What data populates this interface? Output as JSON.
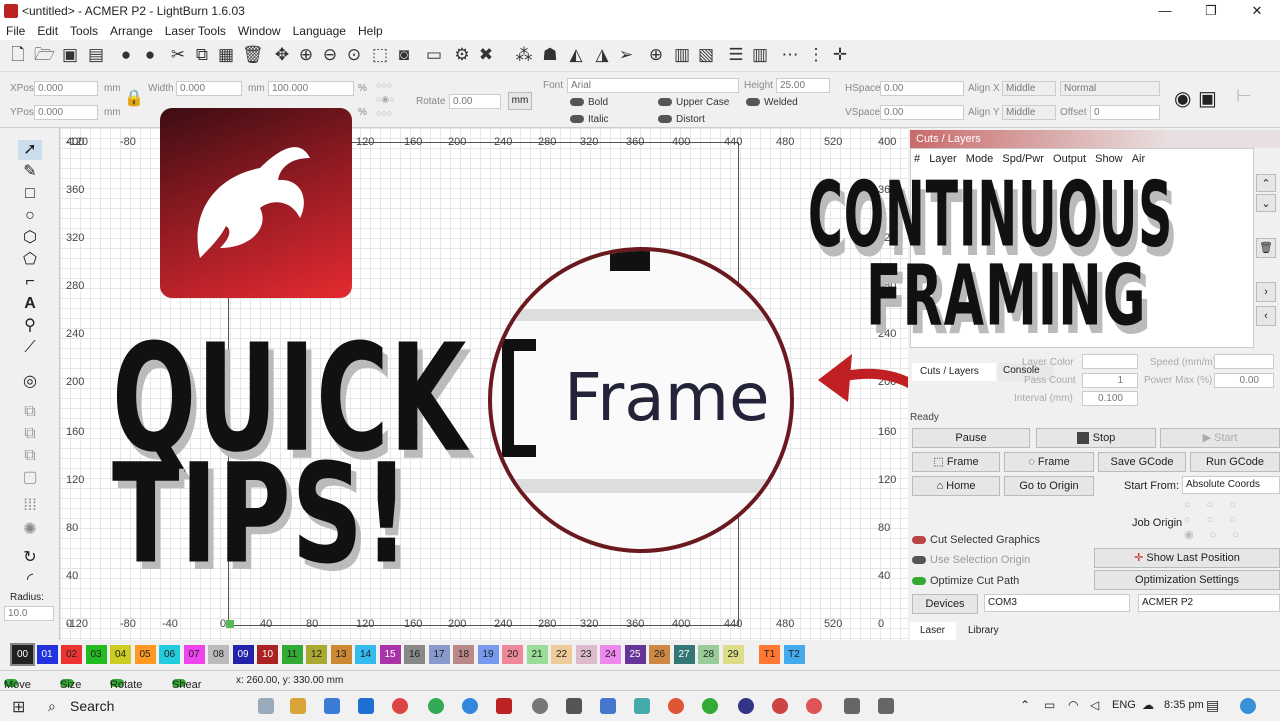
{
  "window": {
    "title": "<untitled> - ACMER P2 - LightBurn 1.6.03"
  },
  "menu": [
    "File",
    "Edit",
    "Tools",
    "Arrange",
    "Laser Tools",
    "Window",
    "Language",
    "Help"
  ],
  "position": {
    "xpos_label": "XPos",
    "xpos_value": "0.000",
    "ypos_label": "YPos",
    "ypos_value": "0.000",
    "unit": "mm",
    "width_label": "Width",
    "width_value": "0.000",
    "height_label": "Height",
    "height_value": "",
    "scale_value": "100.000",
    "pct": "%",
    "rotate_label": "Rotate",
    "rotate_value": "0.00",
    "mm_button": "mm"
  },
  "font_bar": {
    "font_label": "Font",
    "font_value": "Arial",
    "height_label": "Height",
    "height_value": "25.00",
    "hspace_label": "HSpace",
    "hspace_value": "0.00",
    "vspace_label": "VSpace",
    "vspace_value": "0.00",
    "alignx_label": "Align X",
    "alignx_value": "Middle",
    "aligny_label": "Align Y",
    "aligny_value": "Middle",
    "style_value": "Normal",
    "offset_label": "Offset",
    "offset_value": "0",
    "bold": "Bold",
    "italic": "Italic",
    "upper": "Upper Case",
    "distort": "Distort",
    "welded": "Welded"
  },
  "rulers": {
    "top": [
      "-120",
      "-80",
      "-40",
      "0",
      "40",
      "80",
      "120",
      "160",
      "200",
      "240",
      "280",
      "320",
      "360",
      "400",
      "440",
      "480",
      "520"
    ],
    "left": [
      "400",
      "360",
      "320",
      "280",
      "240",
      "200",
      "160",
      "120",
      "80",
      "40",
      "0"
    ],
    "bottom": [
      "-120",
      "-80",
      "-40",
      "0",
      "40",
      "80",
      "120",
      "160",
      "200",
      "240",
      "280",
      "320",
      "360",
      "400",
      "440",
      "480",
      "520"
    ],
    "right": [
      "400",
      "360",
      "320",
      "280",
      "240",
      "200",
      "160",
      "120",
      "80",
      "40",
      "0"
    ]
  },
  "left_tools": {
    "radius_label": "Radius:",
    "radius_value": "10.0"
  },
  "overlay": {
    "quick": "QUICK",
    "tips": "TIPS!",
    "continuous": "CONTINUOUS",
    "framing": "FRAMING",
    "frame_zoom": "Frame"
  },
  "cuts": {
    "panel_title": "Cuts / Layers",
    "columns": [
      "#",
      "Layer",
      "Mode",
      "Spd/Pwr",
      "Output",
      "Show",
      "Air"
    ],
    "tab_cuts": "Cuts / Layers",
    "tab_console": "Console",
    "layer_color": "Layer Color",
    "speed": "Speed (mm/m)",
    "pass_count": "Pass Count",
    "pass_value": "1",
    "power_max": "Power Max (%)",
    "power_value": "0.00",
    "interval": "Interval (mm)",
    "interval_value": "0.100"
  },
  "laser": {
    "ready": "Ready",
    "pause": "Pause",
    "stop": "Stop",
    "start": "Start",
    "frame1": "Frame",
    "frame2": "Frame",
    "save_gcode": "Save GCode",
    "run_gcode": "Run GCode",
    "home": "Home",
    "go_origin": "Go to Origin",
    "start_from_label": "Start From:",
    "start_from_value": "Absolute Coords",
    "job_origin": "Job Origin",
    "cut_selected": "Cut Selected Graphics",
    "use_selection": "Use Selection Origin",
    "optimize": "Optimize Cut Path",
    "show_last": "Show Last Position",
    "opt_settings": "Optimization Settings",
    "devices": "Devices",
    "com": "COM3",
    "device_name": "ACMER P2",
    "tab_laser": "Laser",
    "tab_library": "Library"
  },
  "palette": [
    {
      "n": "00",
      "c": "#222222"
    },
    {
      "n": "01",
      "c": "#2233dd"
    },
    {
      "n": "02",
      "c": "#ee3333"
    },
    {
      "n": "03",
      "c": "#22bb22"
    },
    {
      "n": "04",
      "c": "#cccc22"
    },
    {
      "n": "05",
      "c": "#ff9922"
    },
    {
      "n": "06",
      "c": "#22ccdd"
    },
    {
      "n": "07",
      "c": "#ee44ee"
    },
    {
      "n": "08",
      "c": "#bbbbbb"
    },
    {
      "n": "09",
      "c": "#2222aa"
    },
    {
      "n": "10",
      "c": "#aa2222"
    },
    {
      "n": "11",
      "c": "#33aa33"
    },
    {
      "n": "12",
      "c": "#aaaa33"
    },
    {
      "n": "13",
      "c": "#cc8833"
    },
    {
      "n": "14",
      "c": "#33bbee"
    },
    {
      "n": "15",
      "c": "#aa33aa"
    },
    {
      "n": "16",
      "c": "#888888"
    },
    {
      "n": "17",
      "c": "#8899cc"
    },
    {
      "n": "18",
      "c": "#bb8888"
    },
    {
      "n": "19",
      "c": "#7799ee"
    },
    {
      "n": "20",
      "c": "#ee8899"
    },
    {
      "n": "21",
      "c": "#99dd99"
    },
    {
      "n": "22",
      "c": "#eecc99"
    },
    {
      "n": "23",
      "c": "#ddbbcc"
    },
    {
      "n": "24",
      "c": "#ee88ee"
    },
    {
      "n": "25",
      "c": "#663399"
    },
    {
      "n": "26",
      "c": "#cc8844"
    },
    {
      "n": "27",
      "c": "#337777"
    },
    {
      "n": "28",
      "c": "#99cc99"
    },
    {
      "n": "29",
      "c": "#dddd88"
    },
    {
      "n": "T1",
      "c": "#ff7733"
    },
    {
      "n": "T2",
      "c": "#44aaee"
    }
  ],
  "status": {
    "move": "Move",
    "size": "Size",
    "rotate": "Rotate",
    "shear": "Shear",
    "coords": "x: 260.00, y: 330.00 mm"
  },
  "taskbar": {
    "search": "Search",
    "lang": "ENG",
    "time": "8:35 pm"
  }
}
